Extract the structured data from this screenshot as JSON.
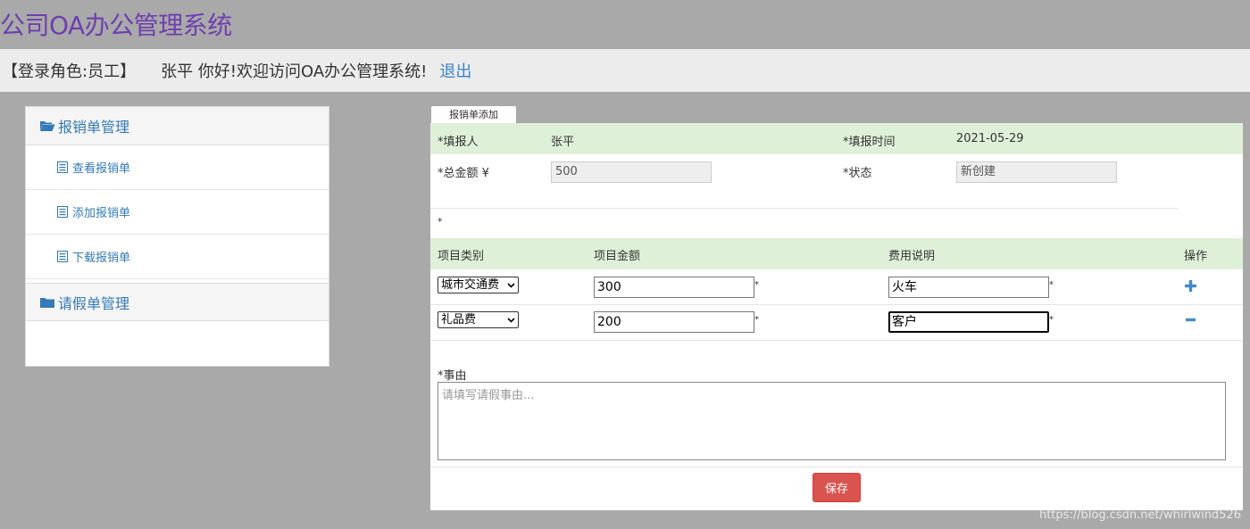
{
  "app": {
    "title": "公司OA办公管理系统"
  },
  "userbar": {
    "role": "【登录角色:员工】",
    "greeting": "张平 你好!欢迎访问OA办公管理系统!",
    "logout": "退出"
  },
  "sidebar": {
    "groups": [
      {
        "label": "报销单管理",
        "icon": "folder-open-icon",
        "items": [
          {
            "label": "查看报销单"
          },
          {
            "label": "添加报销单"
          },
          {
            "label": "下载报销单"
          }
        ]
      },
      {
        "label": "请假单管理",
        "icon": "folder-icon"
      }
    ]
  },
  "form": {
    "tab": "报销单添加",
    "reporter_label": "*填报人",
    "reporter_value": "张平",
    "time_label": "*填报时间",
    "time_value": "2021-05-29",
    "total_label": "*总金额 ¥",
    "total_value": "500",
    "status_label": "*状态",
    "status_value": "新创建",
    "star_marker": "*",
    "columns": {
      "type": "项目类别",
      "amount": "项目金额",
      "desc": "费用说明",
      "op": "操作"
    },
    "items": [
      {
        "type": "城市交通费",
        "amount": "300",
        "desc": "火车",
        "star": "*"
      },
      {
        "type": "礼品费",
        "amount": "200",
        "desc": "客户",
        "star": "*"
      }
    ],
    "reason_label": "*事由",
    "reason_placeholder": "请填写请假事由...",
    "save": "保存"
  },
  "watermark": "https://blog.csdn.net/whirlwind526",
  "colors": {
    "title": "#6f3fb0",
    "link": "#337ab7",
    "green_row": "#dff0d8",
    "save": "#d9534f"
  }
}
